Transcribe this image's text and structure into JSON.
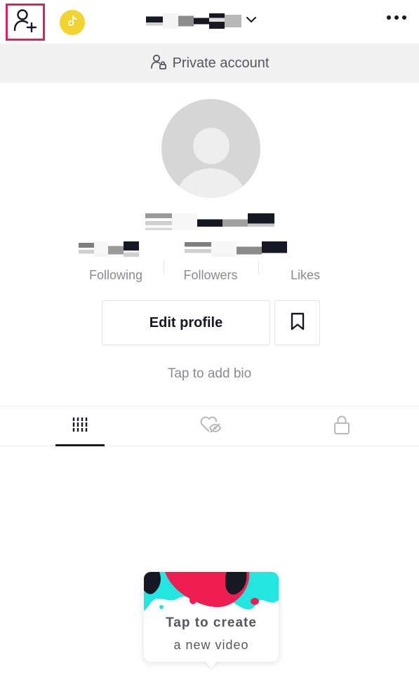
{
  "topbar": {
    "add_friend_icon": "person-plus-icon",
    "coin_icon": "tiktok-coin-icon",
    "username_redacted": true,
    "dropdown_icon": "chevron-down-icon",
    "more_icon": "more-dots-icon",
    "highlight_color": "#d6245a"
  },
  "private_banner": {
    "icon": "person-lock-icon",
    "label": "Private account"
  },
  "profile": {
    "avatar_icon": "default-avatar-icon",
    "handle_redacted": true
  },
  "stats": [
    {
      "label": "Following",
      "value_redacted": true
    },
    {
      "label": "Followers",
      "value_redacted": true
    },
    {
      "label": "Likes",
      "value_redacted": false
    }
  ],
  "actions": {
    "edit_profile_label": "Edit profile",
    "bookmark_icon": "bookmark-icon"
  },
  "bio": {
    "placeholder": "Tap to add bio"
  },
  "tabs": [
    {
      "name": "videos",
      "icon": "grid-bars-icon",
      "active": true
    },
    {
      "name": "liked",
      "icon": "hidden-heart-icon",
      "active": false
    },
    {
      "name": "private",
      "icon": "lock-icon",
      "active": false
    }
  ],
  "create_card": {
    "title": "Tap to create",
    "subtitle": "a new video",
    "colors": {
      "red": "#ee1d52",
      "cyan": "#25e5e0",
      "black": "#161823"
    }
  }
}
